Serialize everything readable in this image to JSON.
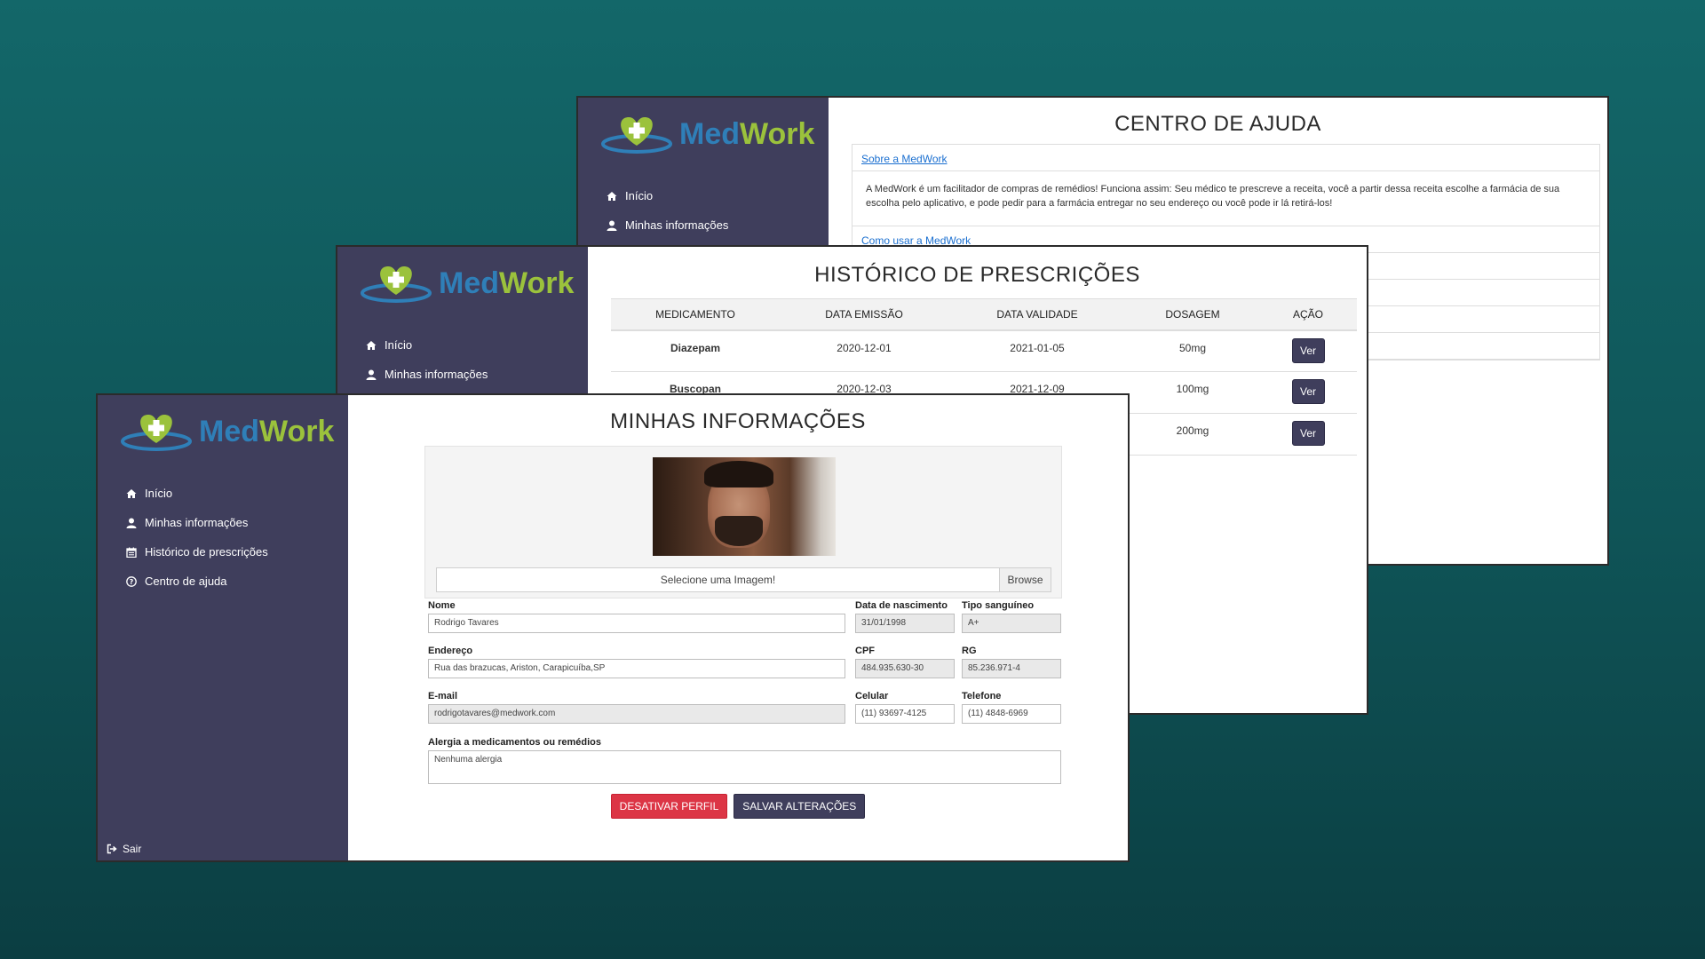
{
  "brand": {
    "part1": "Med",
    "part2": "Work",
    "color1": "#2f7fb8",
    "color2": "#9bc23c"
  },
  "colors": {
    "sidebar": "#3f3e5c",
    "danger": "#dc3545",
    "link": "#1a6fd0"
  },
  "nav": {
    "home": "Início",
    "my_info": "Minhas informações",
    "history": "Histórico de prescrições",
    "history_partial": "Histórico de prescrições",
    "help": "Centro de ajuda",
    "logout": "Sair"
  },
  "help": {
    "title": "CENTRO DE AJUDA",
    "q1": "Sobre a MedWork",
    "a1": "A MedWork é um facilitador de compras de remédios! Funciona assim: Seu médico te prescreve a receita, você a partir dessa receita escolhe a farmácia de sua escolha pelo aplicativo, e pode pedir para a farmácia entregar no seu endereço ou você pode ir lá retirá-los!",
    "q2": "Como usar a MedWork"
  },
  "prescriptions": {
    "title": "HISTÓRICO DE PRESCRIÇÕES",
    "columns": [
      "MEDICAMENTO",
      "DATA EMISSÃO",
      "DATA VALIDADE",
      "DOSAGEM",
      "AÇÃO"
    ],
    "rows": [
      {
        "name": "Diazepam",
        "issued": "2020-12-01",
        "valid": "2021-01-05",
        "dose": "50mg",
        "action": "Ver"
      },
      {
        "name": "Buscopan",
        "issued": "2020-12-03",
        "valid": "2021-12-09",
        "dose": "100mg",
        "action": "Ver"
      },
      {
        "name": "",
        "issued": "",
        "valid": "",
        "dose": "200mg",
        "action": "Ver"
      }
    ]
  },
  "profile": {
    "title": "MINHAS INFORMAÇÕES",
    "image_placeholder": "Selecione uma Imagem!",
    "browse": "Browse",
    "fields": {
      "name": {
        "label": "Nome",
        "value": "Rodrigo Tavares"
      },
      "birth": {
        "label": "Data de nascimento",
        "value": "31/01/1998"
      },
      "blood": {
        "label": "Tipo sanguíneo",
        "value": "A+"
      },
      "address": {
        "label": "Endereço",
        "value": "Rua das brazucas, Ariston, Carapicuíba,SP"
      },
      "cpf": {
        "label": "CPF",
        "value": "484.935.630-30"
      },
      "rg": {
        "label": "RG",
        "value": "85.236.971-4"
      },
      "email": {
        "label": "E-mail",
        "value": "rodrigotavares@medwork.com"
      },
      "mobile": {
        "label": "Celular",
        "value": "(11) 93697-4125"
      },
      "phone": {
        "label": "Telefone",
        "value": "(11) 4848-6969"
      },
      "allergy": {
        "label": "Alergia a medicamentos ou remédios",
        "value": "Nenhuma alergia"
      }
    },
    "deactivate": "DESATIVAR PERFIL",
    "save": "SALVAR ALTERAÇÕES"
  }
}
